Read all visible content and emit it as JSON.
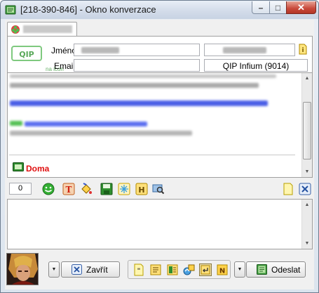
{
  "window": {
    "title": "[218-390-846] - Okno konverzace",
    "controls": {
      "minimize": "–",
      "maximize": "□",
      "close": "✕"
    }
  },
  "tab": {
    "label_redacted": true
  },
  "contact_info": {
    "name_label": "Jméno:",
    "email_label": "Email:",
    "client": "QIP Infium (9014)",
    "logo_text": "na icon"
  },
  "history": {
    "status": "Doma"
  },
  "toolbar": {
    "counter": "0",
    "icons": [
      "smiley-icon",
      "text-format-icon",
      "paint-bucket-icon",
      "save-icon",
      "snowflake-icon",
      "history-icon",
      "search-icon",
      "note-icon",
      "close-tab-icon"
    ]
  },
  "bottom": {
    "close_label": "Zavřít",
    "send_label": "Odeslat",
    "group_icons": [
      "quote-icon",
      "notes-icon",
      "contact-card-icon",
      "transfer-icon",
      "enter-icon",
      "nudge-icon"
    ]
  },
  "colors": {
    "status": "#e01010",
    "link_blue": "#3b4fe0",
    "green_text": "#2ea82e"
  }
}
